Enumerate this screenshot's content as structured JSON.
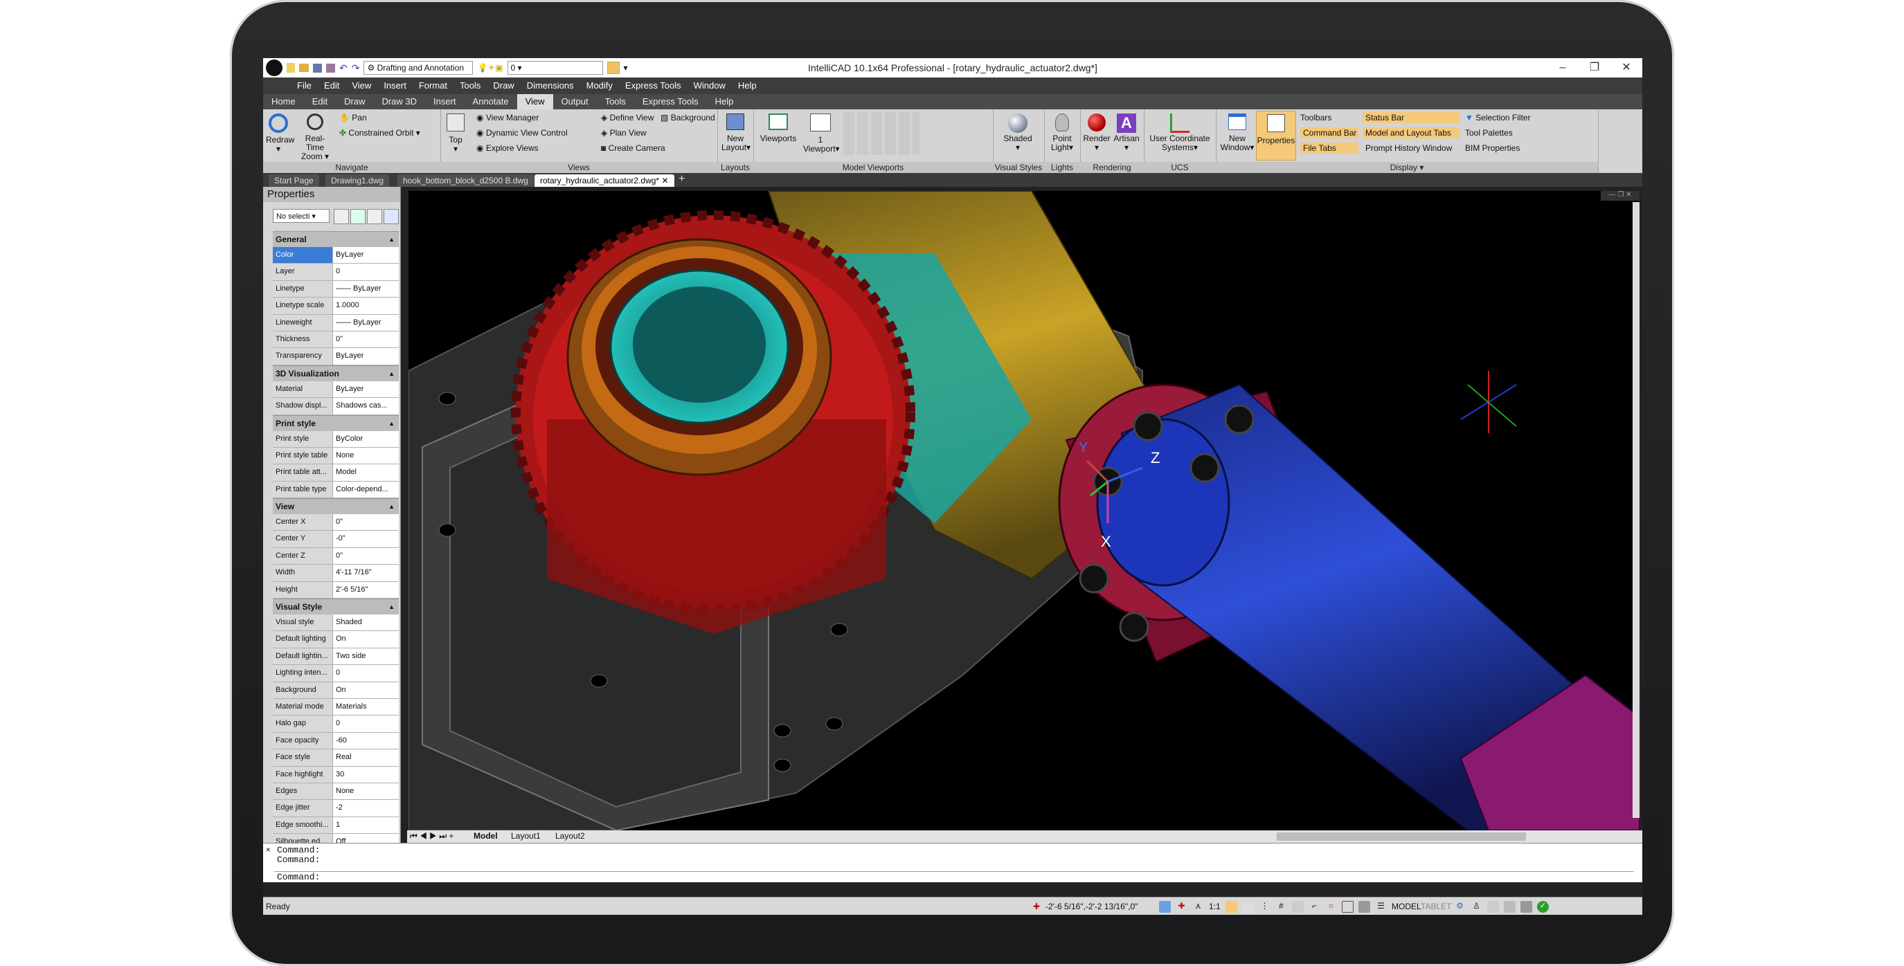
{
  "window": {
    "title": "IntelliCAD 10.1x64 Professional  - [rotary_hydraulic_actuator2.dwg*]"
  },
  "qat": {
    "workspace": "Drafting and Annotation",
    "layer": "0"
  },
  "menu": [
    "File",
    "Edit",
    "View",
    "Insert",
    "Format",
    "Tools",
    "Draw",
    "Dimensions",
    "Modify",
    "Express Tools",
    "Window",
    "Help"
  ],
  "ribbon_tabs": [
    "Home",
    "Edit",
    "Draw",
    "Draw 3D",
    "Insert",
    "Annotate",
    "View",
    "Output",
    "Tools",
    "Express Tools",
    "Help"
  ],
  "ribbon": {
    "navigate": {
      "title": "Navigate",
      "redraw": "Redraw",
      "realtime": "Real-Time",
      "zoom": "Zoom",
      "pan": "Pan",
      "orbit": "Constrained Orbit"
    },
    "views": {
      "title": "Views",
      "top": "Top",
      "view_manager": "View Manager",
      "dynamic": "Dynamic View Control",
      "explore": "Explore Views",
      "define": "Define View",
      "plan": "Plan View",
      "camera": "Create Camera",
      "background": "Background"
    },
    "layouts": {
      "title": "Layouts",
      "new_layout": "New",
      "new_layout2": "Layout"
    },
    "model_viewports": {
      "title": "Model Viewports",
      "viewports": "Viewports",
      "one": "1",
      "viewport": "Viewport"
    },
    "visual_styles": {
      "title": "Visual Styles",
      "shaded": "Shaded"
    },
    "lights": {
      "title": "Lights",
      "point": "Point",
      "light": "Light"
    },
    "rendering": {
      "title": "Rendering",
      "render": "Render",
      "artisan": "Artisan"
    },
    "ucs": {
      "title": "UCS",
      "ucs1": "User Coordinate",
      "ucs2": "Systems"
    },
    "display": {
      "title": "Display",
      "new_window": "New",
      "window": "Window",
      "properties": "Properties",
      "toolbars": "Toolbars",
      "command_bar": "Command Bar",
      "file_tabs": "File Tabs",
      "status_bar": "Status Bar",
      "model_layout_tabs": "Model and Layout Tabs",
      "prompt_history": "Prompt History Window",
      "selection_filter": "Selection Filter",
      "tool_palettes": "Tool Palettes",
      "bim_properties": "BIM Properties"
    }
  },
  "file_tabs": [
    "Start Page",
    "Drawing1.dwg",
    "hook_bottom_block_d2500 B.dwg",
    "rotary_hydraulic_actuator2.dwg*"
  ],
  "properties": {
    "title": "Properties",
    "selection": "No selecti",
    "sections": [
      {
        "name": "General",
        "rows": [
          [
            "Color",
            "ByLayer"
          ],
          [
            "Layer",
            "0"
          ],
          [
            "Linetype",
            "—— ByLayer"
          ],
          [
            "Linetype scale",
            "1.0000"
          ],
          [
            "Lineweight",
            "—— ByLayer"
          ],
          [
            "Thickness",
            "0\""
          ],
          [
            "Transparency",
            "ByLayer"
          ]
        ]
      },
      {
        "name": "3D Visualization",
        "rows": [
          [
            "Material",
            "ByLayer"
          ],
          [
            "Shadow displ...",
            "Shadows cas..."
          ]
        ]
      },
      {
        "name": "Print style",
        "rows": [
          [
            "Print style",
            "ByColor"
          ],
          [
            "Print style table",
            "None"
          ],
          [
            "Print table att...",
            "Model"
          ],
          [
            "Print table type",
            "Color-depend..."
          ]
        ]
      },
      {
        "name": "View",
        "rows": [
          [
            "Center X",
            "0\""
          ],
          [
            "Center Y",
            "-0\""
          ],
          [
            "Center Z",
            "0\""
          ],
          [
            "Width",
            "4'-11 7/16\""
          ],
          [
            "Height",
            "2'-6 5/16\""
          ]
        ]
      },
      {
        "name": "Visual Style",
        "rows": [
          [
            "Visual style",
            "Shaded"
          ],
          [
            "Default lighting",
            "On"
          ],
          [
            "Default lightin...",
            "Two side"
          ],
          [
            "Lighting inten...",
            "0"
          ],
          [
            "Background",
            "On"
          ],
          [
            "Material mode",
            "Materials"
          ],
          [
            "Halo gap",
            "0"
          ],
          [
            "Face opacity",
            "-60"
          ],
          [
            "Face style",
            "Real"
          ],
          [
            "Face highlight",
            "30"
          ],
          [
            "Edges",
            "None"
          ],
          [
            "Edge jitter",
            "-2"
          ],
          [
            "Edge smoothi...",
            "1"
          ],
          [
            "Silhouette ed...",
            "Off"
          ]
        ]
      }
    ]
  },
  "ucs_labels": {
    "x": "X",
    "y": "Y",
    "z": "Z"
  },
  "layout_tabs": [
    "Model",
    "Layout1",
    "Layout2"
  ],
  "command": {
    "lines": [
      "Command:",
      "Command:"
    ],
    "prompt": "Command:"
  },
  "status": {
    "ready": "Ready",
    "coords": "-2'-6 5/16\",-2'-2 13/16\",0\"",
    "scale": "1:1",
    "model": "MODEL",
    "tablet": "TABLET"
  }
}
